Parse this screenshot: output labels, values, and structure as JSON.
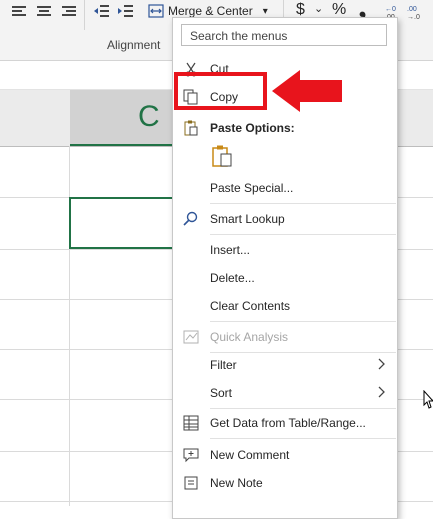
{
  "ribbon": {
    "merge_label": "Merge & Center",
    "merge_chevron": "▾",
    "currency_symbol": "$",
    "currency_chevron": "⌄",
    "percent_symbol": "%",
    "comma_symbol": "❟",
    "group_label": "Alignment",
    "icons": [
      "align-left-icon",
      "align-center-icon",
      "align-right-icon",
      "decrease-indent-icon",
      "increase-indent-icon",
      "merge-icon",
      "decimal-icon"
    ]
  },
  "column_header": {
    "label": "C"
  },
  "context_menu": {
    "search_placeholder": "Search the menus",
    "items": [
      {
        "label": "Cut",
        "icon": "scissors-icon"
      },
      {
        "label": "Copy",
        "icon": "copy-icon"
      },
      {
        "label": "Paste Options:",
        "icon": "paste-icon"
      },
      {
        "label": "Paste Special...",
        "icon": ""
      },
      {
        "label": "Smart Lookup",
        "icon": "search-icon"
      },
      {
        "label": "Insert...",
        "icon": ""
      },
      {
        "label": "Delete...",
        "icon": ""
      },
      {
        "label": "Clear Contents",
        "icon": ""
      },
      {
        "label": "Quick Analysis",
        "icon": "quick-analysis-icon",
        "disabled": true
      },
      {
        "label": "Filter",
        "icon": "",
        "submenu": true
      },
      {
        "label": "Sort",
        "icon": "",
        "submenu": true
      },
      {
        "label": "Get Data from Table/Range...",
        "icon": "table-icon"
      },
      {
        "label": "New Comment",
        "icon": "comment-icon"
      },
      {
        "label": "New Note",
        "icon": "note-icon"
      }
    ]
  },
  "annotation": {
    "highlight_color": "#e8141c"
  },
  "colors": {
    "excel_green": "#217346",
    "ribbon_bg": "#f3f3f3"
  }
}
